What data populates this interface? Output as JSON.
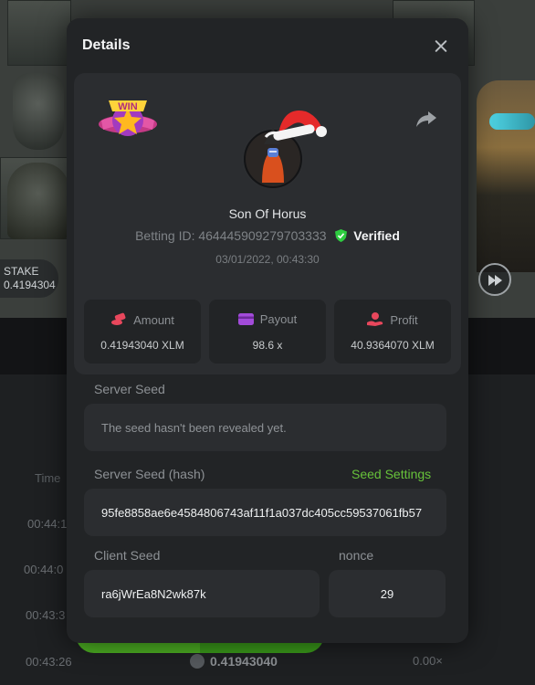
{
  "background": {
    "stake_label": "STAKE",
    "stake_amount": "0.4194304",
    "column_header": "Time",
    "times": [
      "00:44:1",
      "00:44:0",
      "00:43:3",
      "00:43:26"
    ],
    "bottom_amount": "0.41943040",
    "bottom_multiplier": "0.00×"
  },
  "modal": {
    "title": "Details",
    "win_badge_text": "WIN",
    "user_name": "Son Of Horus",
    "betting_id_label": "Betting ID:",
    "betting_id": "464445909279703333",
    "verified_label": "Verified",
    "date": "03/01/2022, 00:43:30",
    "stats": [
      {
        "label": "Amount",
        "value": "0.41943040 XLM",
        "icon": "coins-icon",
        "color": "#e8475c"
      },
      {
        "label": "Payout",
        "value": "98.6 x",
        "icon": "wallet-icon",
        "color": "#a24bd9"
      },
      {
        "label": "Profit",
        "value": "40.9364070 XLM",
        "icon": "hand-coin-icon",
        "color": "#e8475c"
      }
    ],
    "server_seed_label": "Server Seed",
    "server_seed_value": "The seed hasn't been revealed yet.",
    "server_seed_hash_label": "Server Seed (hash)",
    "seed_settings_label": "Seed Settings",
    "server_seed_hash": "95fe8858ae6e4584806743af11f1a037dc405cc59537061fb57",
    "client_seed_label": "Client Seed",
    "client_seed": "ra6jWrEa8N2wk87k",
    "nonce_label": "nonce",
    "nonce": "29"
  },
  "colors": {
    "accent_green": "#67c23a",
    "verified_green": "#2ecc40",
    "amount_icon": "#e8475c",
    "payout_icon": "#a24bd9"
  }
}
